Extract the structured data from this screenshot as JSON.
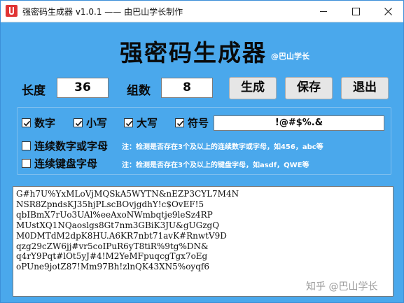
{
  "window": {
    "title": "强密码生成器 v1.0.1  —— 由巴山学长制作",
    "icon": "app-lock-icon",
    "accent_color": "#4aa8ec"
  },
  "header": {
    "title": "强密码生成器",
    "author": "@巴山学长"
  },
  "controls": {
    "length_label": "长度",
    "length_value": "36",
    "groups_label": "组数",
    "groups_value": "8",
    "generate_label": "生成",
    "save_label": "保存",
    "exit_label": "退出"
  },
  "options": {
    "digits": {
      "label": "数字",
      "checked": true
    },
    "lowercase": {
      "label": "小写",
      "checked": true
    },
    "uppercase": {
      "label": "大写",
      "checked": true
    },
    "symbols": {
      "label": "符号",
      "checked": true
    },
    "symbols_value": "!@#$%.&",
    "consecutive_alnum": {
      "label": "连续数字或字母",
      "checked": false
    },
    "consecutive_alnum_note": "注：检测是否存在3个及以上的连续数字或字母，如456，abc等",
    "consecutive_keyboard": {
      "label": "连续键盘字母",
      "checked": false
    },
    "consecutive_keyboard_note": "注：检测是否存在3个及以上的键盘字母，如asdf，QWE等"
  },
  "output": {
    "lines": [
      "G#h7U%YxMLoVjMQSkA5WYTN&nEZP3CYL7M4N",
      "NSR8ZpndsKJ35hjPLscBOvjgdhY!c$OvEF!5",
      "qbIBmX7rUo3UAl%eeAxoNWmbqtje9leSz4RP",
      "MUstXQ1NQaoslgs8Gt7nm3GBiK3JU&gUGzgQ",
      "M0DMTdM2dpK8HU.A6KR7nbt71avK#RnwtV9D",
      "qzg29cZW6jj#vr5coIPuR6yT8tiR%9tg%DN&",
      "q4rY9Pqt#lOt5yJ#4!M2YeMFpuqcgTgx7oEg",
      "oPUne9jotZ87!Mm97Bh!zlnQK43XN5%oyqf6"
    ]
  },
  "watermark": "知乎 @巴山学长"
}
